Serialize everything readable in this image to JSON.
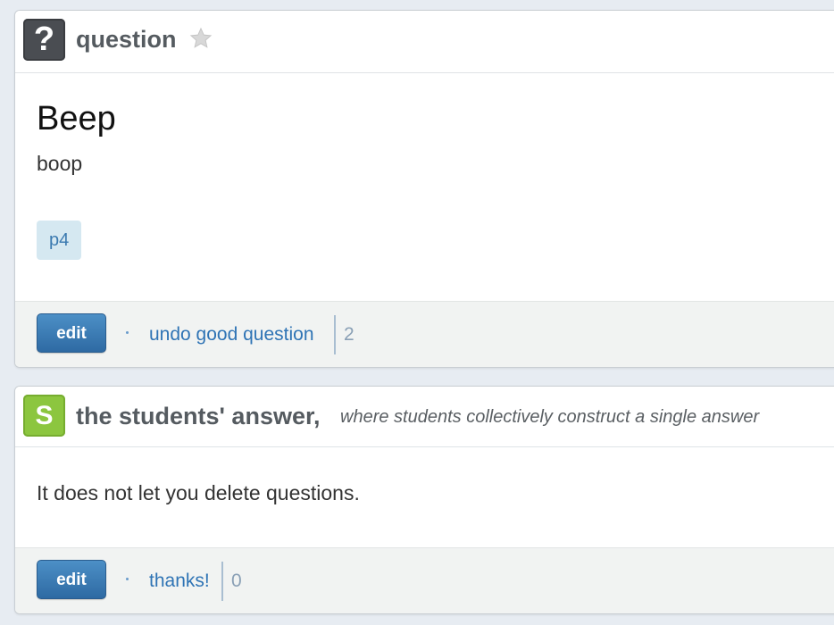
{
  "question_card": {
    "icon_glyph": "?",
    "header_title": "question",
    "star_icon": "star-outline-icon",
    "title": "Beep",
    "body": "boop",
    "tag": "p4",
    "edit_label": "edit",
    "action_link": "undo good question",
    "count": "2"
  },
  "answer_card": {
    "icon_glyph": "S",
    "header_title": "the students' answer,",
    "header_subtitle": "where students collectively construct a single answer",
    "body": "It does not let you delete questions.",
    "edit_label": "edit",
    "action_link": "thanks!",
    "count": "0"
  },
  "colors": {
    "question_icon_bg": "#4a4d52",
    "student_icon_bg": "#8cc63f",
    "edit_button": "#3a7bb6",
    "link": "#2f74b5",
    "tag_bg": "#d5e8f1"
  }
}
